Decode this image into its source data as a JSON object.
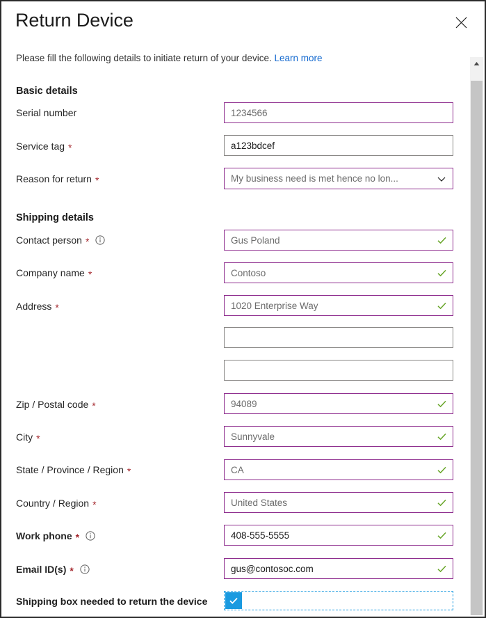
{
  "dialog": {
    "title": "Return Device",
    "close_icon": "close-icon",
    "subtitle_text": "Please fill the following details to initiate return of your device.",
    "learn_more_label": "Learn more"
  },
  "sections": {
    "basic": {
      "heading": "Basic details"
    },
    "shipping": {
      "heading": "Shipping details"
    }
  },
  "fields": {
    "serial_number": {
      "label": "Serial number",
      "value": "1234566"
    },
    "service_tag": {
      "label": "Service tag",
      "value": "a123bdcef"
    },
    "reason_for_return": {
      "label": "Reason for return",
      "value": "My business need is met hence no lon..."
    },
    "contact_person": {
      "label": "Contact person",
      "value": "Gus Poland"
    },
    "company_name": {
      "label": "Company name",
      "value": "Contoso"
    },
    "address": {
      "label": "Address",
      "value": "1020 Enterprise Way",
      "line2": "",
      "line3": ""
    },
    "zip": {
      "label": "Zip / Postal code",
      "value": "94089"
    },
    "city": {
      "label": "City",
      "value": "Sunnyvale"
    },
    "state": {
      "label": "State / Province / Region",
      "value": "CA"
    },
    "country": {
      "label": "Country / Region",
      "value": "United States"
    },
    "work_phone": {
      "label": "Work phone",
      "value": "408-555-5555"
    },
    "email": {
      "label": "Email ID(s)",
      "value": "gus@contosoc.com"
    },
    "shipping_box": {
      "label": "Shipping box needed to return the device",
      "checked": true
    }
  },
  "markers": {
    "required_star": "*",
    "info_icon": "info-icon",
    "valid_icon": "checkmark-icon",
    "dropdown_icon": "chevron-down-icon",
    "scroll_up_icon": "triangle-up-icon"
  },
  "colors": {
    "accent_purple": "#8e2d8e",
    "valid_green": "#69a62a",
    "required_red": "#a4262c",
    "link_blue": "#1268cf",
    "checkbox_blue": "#1a9ae0"
  }
}
